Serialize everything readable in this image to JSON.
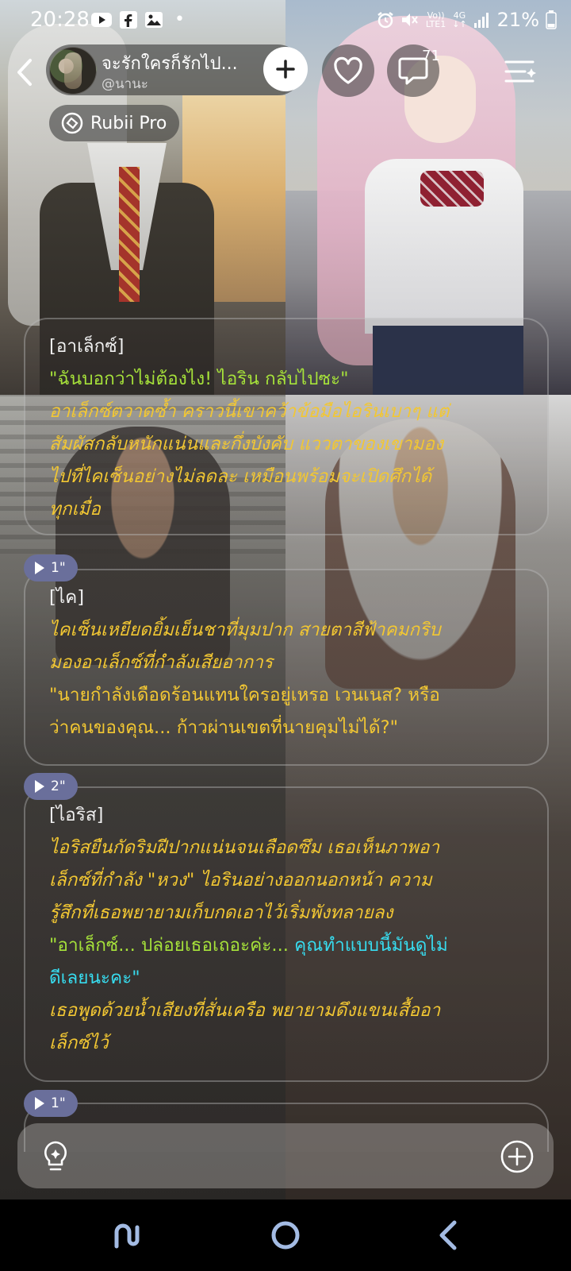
{
  "status_bar": {
    "time": "20:28",
    "dot": "•",
    "network_top": "Vo))",
    "network_bottom": "LTE1",
    "net_type": "4G",
    "battery": "21%",
    "left_icons": [
      "youtube-icon",
      "facebook-icon",
      "gallery-icon"
    ],
    "right_icons": [
      "alarm-icon",
      "mute-icon",
      "signal-icon",
      "battery-icon"
    ]
  },
  "header": {
    "chat_name": "จะรักใครก็รักไป...",
    "handle": "@นานะ",
    "comment_count": "71",
    "badge_label": "Rubii Pro"
  },
  "messages": [
    {
      "speaker": "[อาเล็กซ์]",
      "lines": [
        {
          "style": "speech-g",
          "text": "\"ฉันบอกว่าไม่ต้องไง! ไอริน กลับไปซะ\""
        },
        {
          "style": "narr",
          "text": "อาเล็กซ์ตวาดซ้ำ คราวนี้เขาคว้าข้อมือไอรินเบาๆ แต่"
        },
        {
          "style": "narr",
          "text": "สัมผัสกลับหนักแน่นและกึ่งบังคับ แววตาของเขามอง"
        },
        {
          "style": "narr",
          "text": "ไปที่ไคเซ็นอย่างไม่ลดละ เหมือนพร้อมจะเปิดศึกได้"
        },
        {
          "style": "narr",
          "text": "ทุกเมื่อ"
        }
      ]
    },
    {
      "duration": "1\"",
      "speaker": "[ไค]",
      "lines": [
        {
          "style": "narr",
          "text": "ไคเซ็นเหยียดยิ้มเย็นชาที่มุมปาก สายตาสีฟ้าคมกริบ"
        },
        {
          "style": "narr",
          "text": "มองอาเล็กซ์ที่กำลังเสียอาการ"
        },
        {
          "style": "speech-y",
          "text": "\"นายกำลังเดือดร้อนแทนใครอยู่เหรอ เวนเนส? หรือ"
        },
        {
          "style": "speech-y",
          "text": "ว่าคนของคุณ... ก้าวผ่านเขตที่นายคุมไม่ได้?\""
        }
      ]
    },
    {
      "duration": "2\"",
      "speaker": "[ไอริส]",
      "lines": [
        {
          "style": "narr",
          "text": "ไอริสยืนกัดริมฝีปากแน่นจนเลือดซึม เธอเห็นภาพอา"
        },
        {
          "style": "narr",
          "text": "เล็กซ์ที่กำลัง \"หวง\" ไอรินอย่างออกนอกหน้า ความ"
        },
        {
          "style": "narr",
          "text": "รู้สึกที่เธอพยายามเก็บกดเอาไว้เริ่มพังทลายลง"
        },
        {
          "style": "speech-g",
          "text": "\"อาเล็กซ์... ปล่อยเธอเถอะค่ะ... "
        },
        {
          "style": "speech-c",
          "text": "คุณทำแบบนี้มันดูไม่"
        },
        {
          "style": "speech-c",
          "text": "ดีเลยนะคะ\""
        },
        {
          "style": "narr",
          "text": "เธอพูดด้วยน้ำเสียงที่สั่นเครือ พยายามดึงแขนเสื้ออา"
        },
        {
          "style": "narr",
          "text": "เล็กซ์ไว้"
        }
      ]
    },
    {
      "duration": "1\""
    }
  ],
  "input": {
    "placeholder": "",
    "value": ""
  },
  "colors": {
    "narration": "#f2c733",
    "speech_green": "#a6e23a",
    "speech_cyan": "#37dcef",
    "play_badge": "#6a6f9b"
  }
}
